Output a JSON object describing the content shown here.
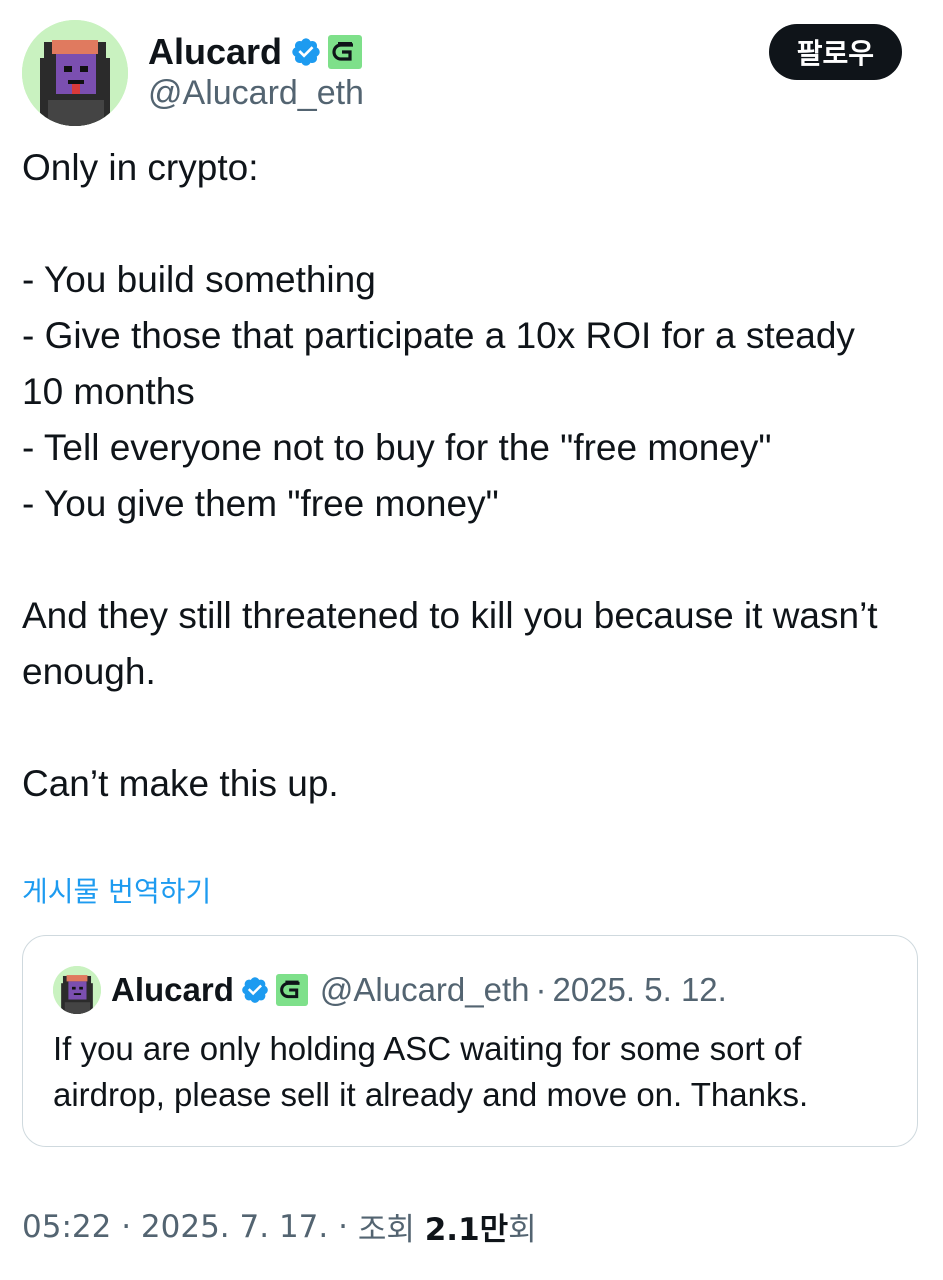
{
  "author": {
    "display_name": "Alucard",
    "handle": "@Alucard_eth",
    "avatar_icon": "pixel-hooded-character-icon",
    "verified_icon": "verified-badge-icon",
    "affiliate_icon": "green-affiliate-badge-icon"
  },
  "follow_label": "팔로우",
  "tweet": {
    "lines": [
      "Only in crypto:",
      "",
      "- You build something",
      "- Give those that participate a 10x ROI for a steady 10 months",
      "- Tell everyone not to buy for the \"free money\"",
      "- You give them \"free money\"",
      "",
      "And they still threatened to kill you because it wasn’t enough.",
      "",
      "Can’t make this up."
    ]
  },
  "translate_label": "게시물 번역하기",
  "quote": {
    "display_name": "Alucard",
    "handle": "@Alucard_eth",
    "separator": "·",
    "date": "2025. 5. 12.",
    "text": "If you are only holding ASC waiting for some sort of airdrop, please sell it already and move on. Thanks."
  },
  "footer": {
    "time": "05:22",
    "sep1": " · ",
    "date": "2025. 7. 17.",
    "sep2": " · ",
    "views_label": "조회 ",
    "views_count": "2.1만",
    "views_suffix": "회"
  },
  "colors": {
    "link": "#1d9bf0",
    "verified": "#1d9bf0",
    "affiliate": "#7ee08a",
    "button": "#0f1419"
  }
}
